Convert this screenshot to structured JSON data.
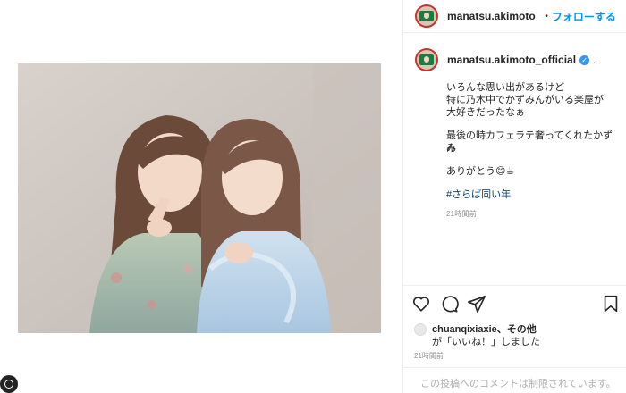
{
  "header": {
    "username": "manatsu.akimoto_",
    "separator": "•",
    "follow_label": "フォローする"
  },
  "post": {
    "author": "manatsu.akimoto_official",
    "verified_glyph": "✓",
    "author_suffix": ".",
    "caption_lines": [
      "いろんな思い出があるけど",
      "特に乃木中でかずみんがいる楽屋が",
      "大好きだったなぁ",
      "最後の時カフェラテ奢ってくれたかずみ",
      "ん",
      "ありがとう😊☕"
    ],
    "hashtag": "#さらば同い年",
    "time": "21時間前"
  },
  "icons": {
    "like": "heart-icon",
    "comment": "comment-icon",
    "share": "share-icon",
    "save": "bookmark-icon"
  },
  "likes": {
    "users": "chuanqixiaxie、その他",
    "text": "が「いいね！」しました"
  },
  "footer": {
    "time": "21時間前",
    "comment_note": "この投稿へのコメントは制限されています。"
  },
  "colors": {
    "accent": "#0095f6",
    "verified": "#3897f0",
    "muted": "#8e8e8e",
    "border": "#efefef"
  }
}
